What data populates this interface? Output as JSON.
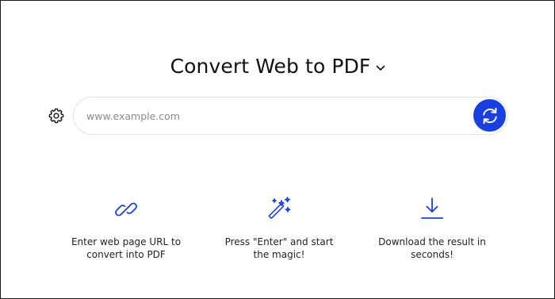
{
  "header": {
    "title": "Convert Web to PDF",
    "title_dropdown_icon": "chevron-down-icon"
  },
  "search": {
    "placeholder": "www.example.com",
    "value": "",
    "settings_icon": "gear-icon",
    "submit_icon": "refresh-icon"
  },
  "features": [
    {
      "icon": "link-icon",
      "line1": "Enter web page URL to",
      "line2": "convert into PDF"
    },
    {
      "icon": "magic-wand-icon",
      "line1": "Press \"Enter\" and start",
      "line2": "the magic!"
    },
    {
      "icon": "download-icon",
      "line1": "Download the result in",
      "line2": "seconds!"
    }
  ],
  "colors": {
    "accent": "#1a3fe0",
    "text": "#111111",
    "border": "#e4e4e4"
  }
}
